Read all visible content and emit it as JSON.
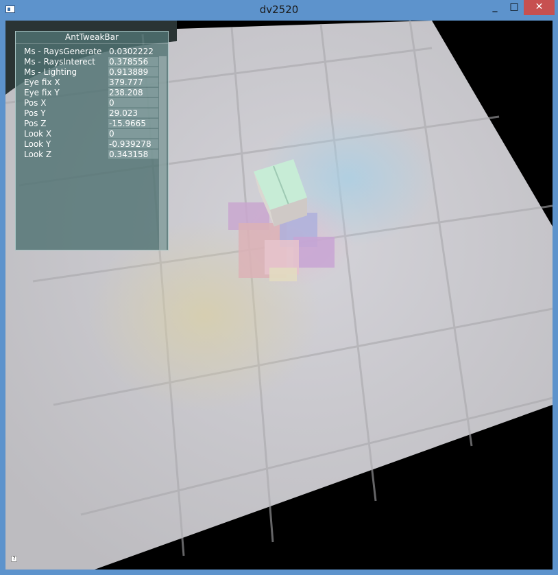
{
  "window": {
    "title": "dv2520",
    "minimize_label": "_",
    "maximize_label": "□",
    "close_label": "✕",
    "accent_color": "#5d93cc",
    "close_color": "#c75050"
  },
  "tweakbar": {
    "title": "AntTweakBar",
    "rows": [
      {
        "label": "Ms - RaysGenerate",
        "value": "0.0302222"
      },
      {
        "label": "Ms - RaysInterect",
        "value": "0.378556"
      },
      {
        "label": "Ms - Lighting",
        "value": "0.913889"
      },
      {
        "label": "Eye fix X",
        "value": "379.777"
      },
      {
        "label": "Eye fix Y",
        "value": "238.208"
      },
      {
        "label": "Pos X",
        "value": "0"
      },
      {
        "label": "Pos Y",
        "value": "29.023"
      },
      {
        "label": "Pos Z",
        "value": "-15.9665"
      },
      {
        "label": "Look X",
        "value": "0"
      },
      {
        "label": "Look Y",
        "value": "-0.939278"
      },
      {
        "label": "Look Z",
        "value": "0.343158"
      }
    ],
    "help_icon": "help-icon"
  }
}
